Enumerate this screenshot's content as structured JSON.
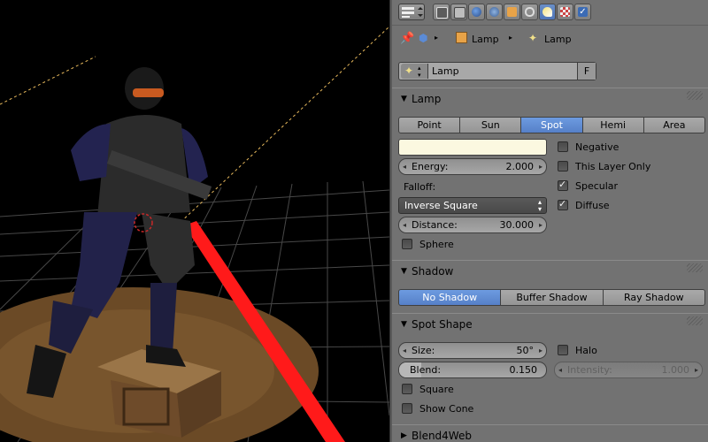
{
  "properties": {
    "breadcrumb": {
      "object": "Lamp",
      "data": "Lamp"
    },
    "datablock": {
      "name": "Lamp",
      "fake_user": "F"
    },
    "lamp_panel": {
      "title": "Lamp",
      "types": [
        "Point",
        "Sun",
        "Spot",
        "Hemi",
        "Area"
      ],
      "selected_type": "Spot",
      "color": "#fbf8e0",
      "energy_label": "Energy:",
      "energy_value": "2.000",
      "falloff_label": "Falloff:",
      "falloff_value": "Inverse Square",
      "distance_label": "Distance:",
      "distance_value": "30.000",
      "sphere_label": "Sphere",
      "sphere_checked": false,
      "negative_label": "Negative",
      "negative_checked": false,
      "layer_only_label": "This Layer Only",
      "layer_only_checked": false,
      "specular_label": "Specular",
      "specular_checked": true,
      "diffuse_label": "Diffuse",
      "diffuse_checked": true
    },
    "shadow_panel": {
      "title": "Shadow",
      "options": [
        "No Shadow",
        "Buffer Shadow",
        "Ray Shadow"
      ],
      "selected": "No Shadow"
    },
    "spot_shape_panel": {
      "title": "Spot Shape",
      "size_label": "Size:",
      "size_value": "50°",
      "blend_label": "Blend:",
      "blend_value": "0.150",
      "blend_fraction": 0.15,
      "halo_label": "Halo",
      "halo_checked": false,
      "intensity_label": "Intensity:",
      "intensity_value": "1.000",
      "square_label": "Square",
      "square_checked": false,
      "show_cone_label": "Show Cone",
      "show_cone_checked": false
    },
    "blend4web_panel": {
      "title": "Blend4Web"
    }
  },
  "colors": {
    "panel_bg": "#727272",
    "selected": "#5680c8",
    "spot_beam": "#ff1a1a",
    "viewport_bg": "#000000"
  }
}
